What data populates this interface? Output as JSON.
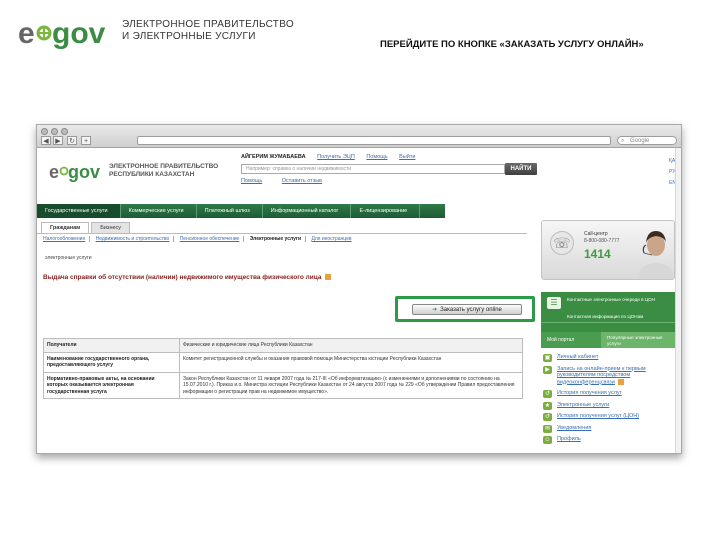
{
  "slide": {
    "heading_line1": "ЭЛЕКТРОННОЕ ПРАВИТЕЛЬСТВО",
    "heading_line2": "И ЭЛЕКТРОННЫЕ УСЛУГИ",
    "instruction": "ПЕРЕЙДИТЕ ПО КНОПКЕ «ЗАКАЗАТЬ УСЛУГУ ОНЛАЙН»"
  },
  "browser": {
    "search_placeholder": "Google"
  },
  "site": {
    "title_line1": "ЭЛЕКТРОННОЕ ПРАВИТЕЛЬСТВО",
    "title_line2": "РЕСПУБЛИКИ КАЗАХСТАН",
    "user_name": "АЙГЕРИМ ЖУМАБАЕВА",
    "user_links": [
      "Получить ЭЦП",
      "Помощь",
      "Выйти"
    ],
    "search_placeholder": "Например: справка о наличии недвижимости",
    "find_button": "НАЙТИ",
    "search_links": [
      "Помощь",
      "Оставить отзыв"
    ],
    "lang_links": [
      "ҚАЗ",
      "РУС",
      "ENG"
    ]
  },
  "nav": {
    "main": [
      "Государственные услуги",
      "Коммерческие услуги",
      "Платежный шлюз",
      "Информационный каталог",
      "Е-лицензирование"
    ],
    "sub_tabs": [
      "Гражданам",
      "Бизнесу"
    ],
    "categories": [
      "Налогообложение",
      "Недвижимость и строительство",
      "Пенсионное обеспечение",
      "Электронные услуги",
      "Для иностранцев"
    ],
    "current_category": "Электронные услуги"
  },
  "page": {
    "breadcrumb": "электронные услуги",
    "service_title": "Выдача справки об отсутствии (наличии) недвижимого имущества физического лица",
    "order_button": "Заказать услугу online"
  },
  "table": {
    "rows": [
      {
        "label": "Получатели",
        "value": "Физические и юридические лица Республики Казахстан"
      },
      {
        "label": "Наименование государственного органа, предоставляющего услугу",
        "value": "Комитет регистрационной службы и оказания правовой помощи Министерства юстиции Республики Казахстан"
      },
      {
        "label": "Нормативно-правовые акты, на основании которых оказывается электронная государственная услуга",
        "value": "Закон Республики Казахстан от 11 января 2007 года № 217-III «Об информатизации» (с изменениями и дополнениями по состоянию на 15.07.2010 г.). Приказ и.о. Министра юстиции Республики Казахстан от 24 августа 2007 года № 229 «Об утверждении Правил предоставления информации о регистрации прав на недвижимое имущество»."
      }
    ]
  },
  "sidebar": {
    "call_center_label": "Call-центр",
    "call_center_phone": "8-800-080-7777",
    "short_number": "1414",
    "green_items": [
      "Контактные электронные очереди в ЦОН",
      "Контактная информация по ЦОНам"
    ],
    "personal_cabinet": "Мой портал",
    "video_service": "Популярные электронные услуги",
    "links": [
      "Личный кабинет",
      "Запись на онлайн-прием к первым руководителям посредством видеоконференцсвязи",
      "История получения услуг",
      "Электронные услуги",
      "История получения услуг (ЦОН)",
      "Уведомления",
      "Профиль"
    ]
  },
  "colors": {
    "nav_green": "#1d5c35",
    "accent_green": "#3a8d43",
    "title_red": "#8a1c1c",
    "link_blue": "#3a6fb0"
  }
}
